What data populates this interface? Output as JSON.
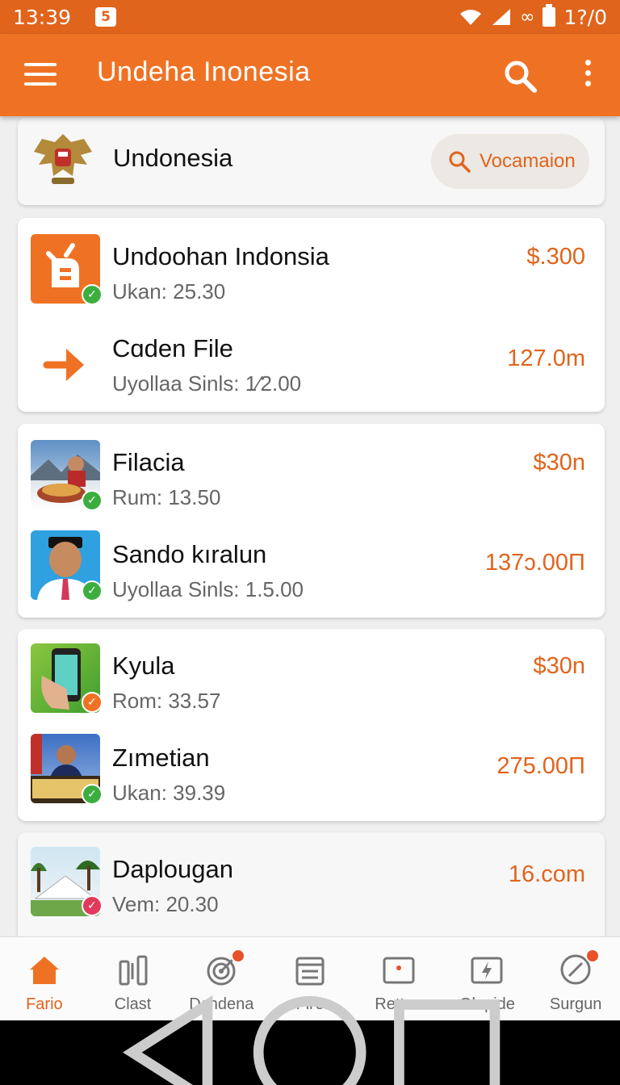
{
  "status_bar": {
    "time": "13:39",
    "notification_icon": "5",
    "battery": "1?/0"
  },
  "app_bar": {
    "title": "Undeha Inonesia"
  },
  "header_card": {
    "name": "Undonesia",
    "search_pill": "Vocamaion"
  },
  "cards": [
    {
      "rows": [
        {
          "title": "Undoohan Indonsia",
          "subtitle": "Ukan: 25.30",
          "price": "$.300",
          "thumb": "file-icon",
          "badge": "check-green"
        },
        {
          "title": "Cɑden File",
          "subtitle": "Uyollaa Sinls: 1⁄2.00",
          "price": "127.0m",
          "thumb": "arrow-right-icon",
          "badge": ""
        }
      ]
    },
    {
      "rows": [
        {
          "title": "Filacia",
          "subtitle": "Rum: 13.50",
          "price": "$30n",
          "thumb": "food-photo",
          "badge": "check-green"
        },
        {
          "title": "Sando kıralun",
          "subtitle": "Uyollaa Sinls: 1.5.00",
          "price": "137ɔ.00Π",
          "thumb": "person-photo",
          "badge": "check-green"
        }
      ]
    },
    {
      "rows": [
        {
          "title": "Kyula",
          "subtitle": "Rom: 33.57",
          "price": "$30n",
          "thumb": "phone-photo",
          "badge": "check-orange"
        },
        {
          "title": "Zımetian",
          "subtitle": "Ukan: 39.39",
          "price": "275.00Π",
          "thumb": "poster-photo",
          "badge": "check-green"
        }
      ]
    },
    {
      "rows": [
        {
          "title": "Daplougan",
          "subtitle": "Vem: 20.30",
          "price": "16.com",
          "thumb": "tent-photo",
          "badge": "check-pink"
        }
      ]
    }
  ],
  "bottom_nav": [
    {
      "label": "Fario",
      "icon": "home-icon",
      "active": true
    },
    {
      "label": "Clast",
      "icon": "columns-icon",
      "active": false
    },
    {
      "label": "Dcndena",
      "icon": "target-icon",
      "active": false
    },
    {
      "label": "Fiᴦe",
      "icon": "calendar-icon",
      "active": false
    },
    {
      "label": "Rettan",
      "icon": "card-icon",
      "active": false
    },
    {
      "label": "Glopide",
      "icon": "flash-card-icon",
      "active": false
    },
    {
      "label": "Surgun",
      "icon": "compass-icon",
      "active": false
    }
  ],
  "colors": {
    "brand": "#ef7224",
    "status": "#e0641c",
    "price": "#e0641c",
    "check_green": "#3cae3f",
    "check_orange": "#ef7224",
    "check_pink": "#e23a5c"
  }
}
